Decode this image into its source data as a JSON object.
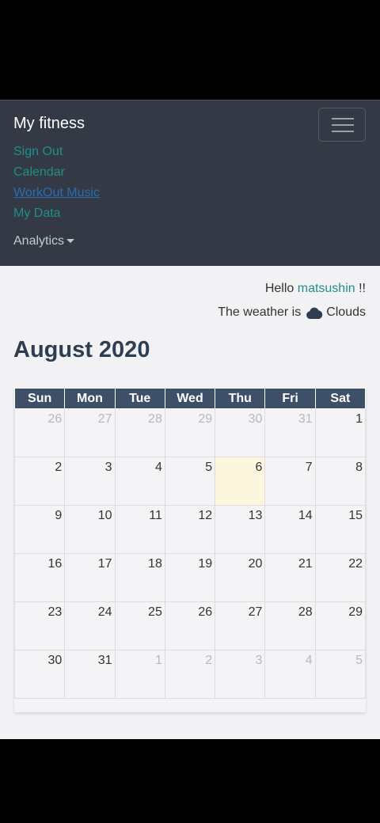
{
  "navbar": {
    "brand": "My fitness",
    "links": [
      "Sign Out",
      "Calendar",
      "WorkOut Music",
      "My Data"
    ],
    "dropdown_label": "Analytics"
  },
  "greeting": {
    "prefix": "Hello",
    "user": "matsushin",
    "suffix": "!!"
  },
  "weather": {
    "prefix": "The weather is",
    "icon": "cloud-icon",
    "condition": "Clouds"
  },
  "calendar": {
    "month_title": "August 2020",
    "weekdays": [
      "Sun",
      "Mon",
      "Tue",
      "Wed",
      "Thu",
      "Fri",
      "Sat"
    ],
    "weeks": [
      [
        "26",
        "27",
        "28",
        "29",
        "30",
        "31",
        "1"
      ],
      [
        "2",
        "3",
        "4",
        "5",
        "6",
        "7",
        "8"
      ],
      [
        "9",
        "10",
        "11",
        "12",
        "13",
        "14",
        "15"
      ],
      [
        "16",
        "17",
        "18",
        "19",
        "20",
        "21",
        "22"
      ],
      [
        "23",
        "24",
        "25",
        "26",
        "27",
        "28",
        "29"
      ],
      [
        "30",
        "31",
        "1",
        "2",
        "3",
        "4",
        "5"
      ]
    ],
    "today": "6"
  },
  "colors": {
    "accent": "#1f8f87",
    "navbar": "#343a45",
    "header": "#3d5068",
    "today": "#fdf6de"
  }
}
